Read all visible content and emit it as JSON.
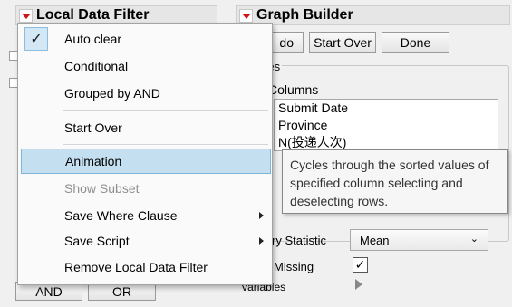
{
  "left_panel": {
    "title": "Local Data Filter"
  },
  "right_panel": {
    "title": "Graph Builder"
  },
  "toolbar": {
    "undo_label": "do",
    "start_over_label": "Start Over",
    "done_label": "Done"
  },
  "variables": {
    "group_label": "ables",
    "columns_label": "Columns",
    "columns": [
      "Submit Date",
      "Province",
      "N(投递人次)"
    ]
  },
  "summary": {
    "label": "ry Statistic",
    "value": "Mean"
  },
  "missing": {
    "label": "Missing",
    "checked_glyph": "✓"
  },
  "variables2": {
    "label": "Variables"
  },
  "bottom_buttons": {
    "and_label": "AND",
    "or_label": "OR"
  },
  "menu": {
    "check_glyph": "✓",
    "items": [
      {
        "label": "Auto clear"
      },
      {
        "label": "Conditional"
      },
      {
        "label": "Grouped by AND"
      },
      {
        "label": "Start Over"
      },
      {
        "label": "Animation"
      },
      {
        "label": "Show Subset"
      },
      {
        "label": "Save Where Clause"
      },
      {
        "label": "Save Script"
      },
      {
        "label": "Remove Local Data Filter"
      }
    ]
  },
  "tooltip": {
    "text": "Cycles through the sorted values of specified column selecting and deselecting rows."
  },
  "colors": {
    "accent_red": "#d0161b",
    "highlight": "#c4dff0",
    "highlight_border": "#7cb6dc"
  }
}
